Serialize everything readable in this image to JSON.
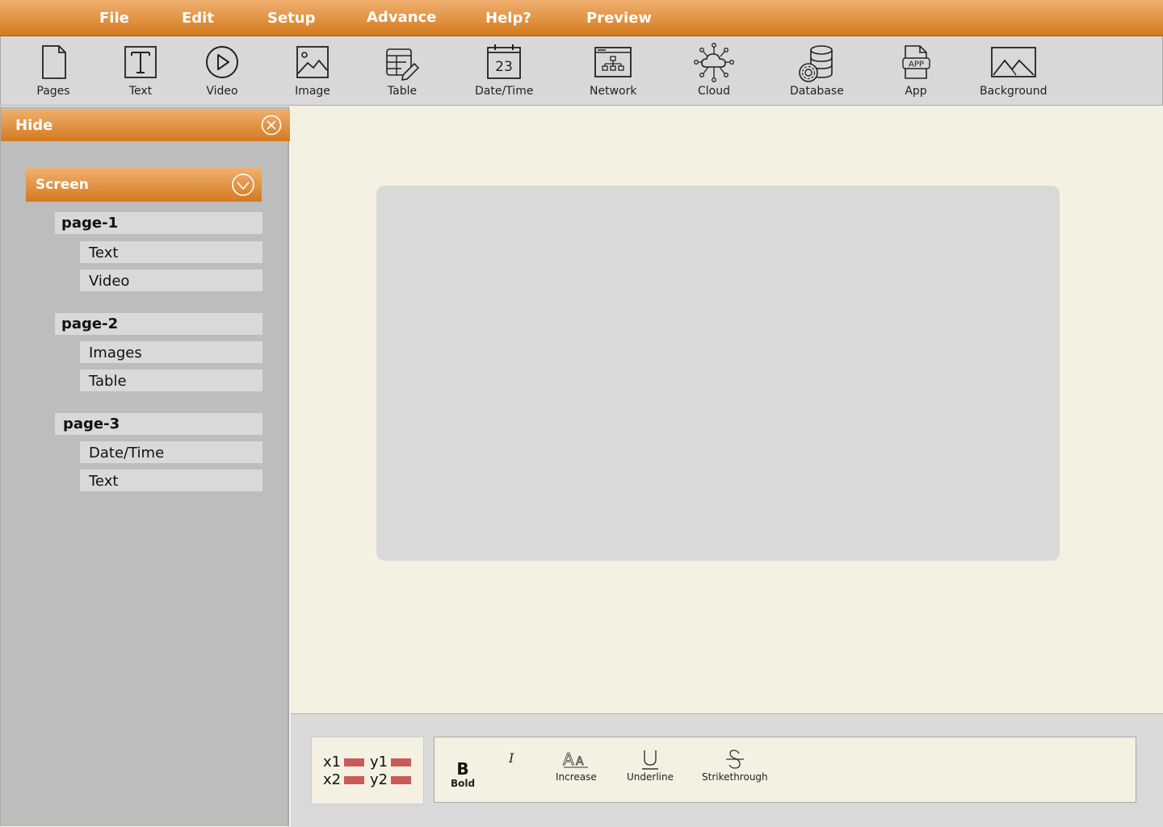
{
  "menu": [
    "File",
    "Edit",
    "Setup",
    "Advance",
    "Help?",
    "Preview"
  ],
  "toolbar": {
    "tools": [
      {
        "label": "Pages",
        "icon": "pages-icon"
      },
      {
        "label": "Text",
        "icon": "text-icon"
      },
      {
        "label": "Video",
        "icon": "video-icon"
      },
      {
        "label": "Image",
        "icon": "image-icon"
      },
      {
        "label": "Table",
        "icon": "table-edit-icon"
      },
      {
        "label": "Date/Time",
        "icon": "calendar-icon",
        "day": "23"
      },
      {
        "label": "Network",
        "icon": "network-icon"
      },
      {
        "label": "Cloud",
        "icon": "cloud-network-icon"
      },
      {
        "label": "Database",
        "icon": "database-gear-icon"
      },
      {
        "label": "App",
        "icon": "app-file-icon",
        "badge": "APP"
      },
      {
        "label": "Background",
        "icon": "landscape-icon"
      }
    ]
  },
  "sidebar": {
    "hide_label": "Hide",
    "screen_label": "Screen",
    "pages": [
      {
        "label": "page-1",
        "items": [
          "Text",
          "Video"
        ]
      },
      {
        "label": "page-2",
        "items": [
          "Images",
          "Table"
        ]
      },
      {
        "label": "page-3",
        "items": [
          "Date/Time",
          "Text"
        ]
      }
    ]
  },
  "coords": {
    "x1": "x1",
    "y1": "y1",
    "x2": "x2",
    "y2": "y2"
  },
  "format": {
    "bold_glyph": "B",
    "bold_label": "Bold",
    "italic_glyph": "I",
    "increase_glyph": "AA",
    "increase_label": "Increase",
    "underline_glyph": "U",
    "underline_label": "Underline",
    "strike_glyph": "S",
    "strike_label": "Strikethrough"
  },
  "colors": {
    "accent_top": "#f0b070",
    "accent_bottom": "#d47a1e",
    "canvas": "#f4f1e3",
    "coord_marker": "#c95a5a"
  }
}
